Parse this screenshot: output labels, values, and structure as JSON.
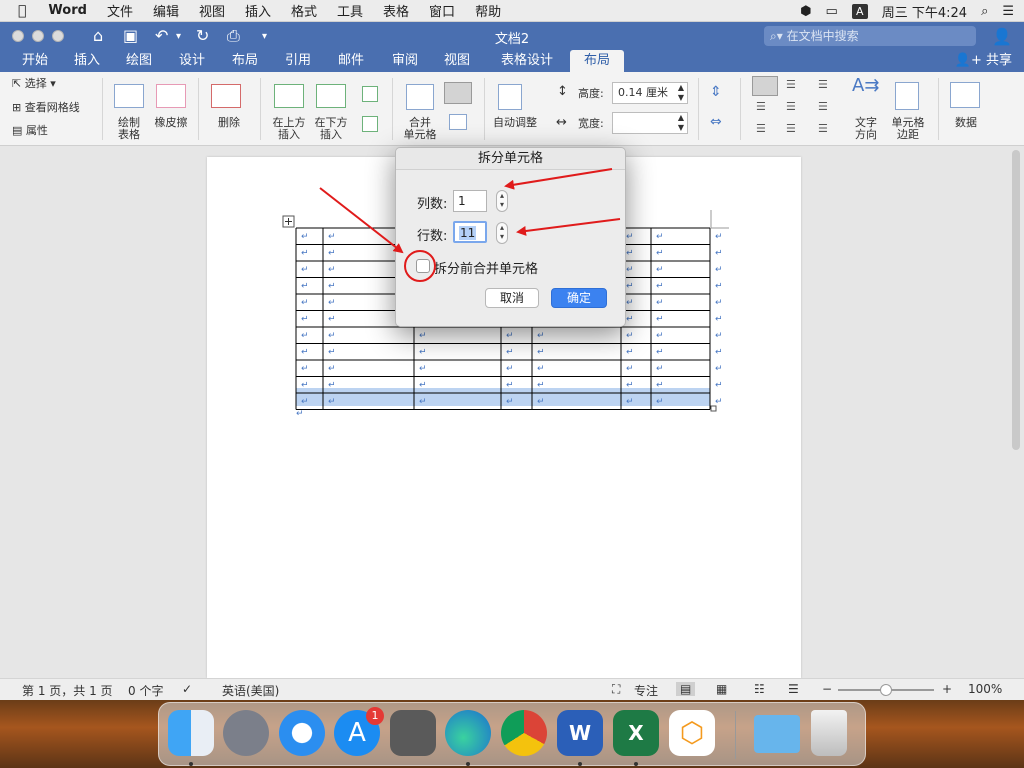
{
  "menubar": {
    "app_name": "Word",
    "items": [
      "文件",
      "编辑",
      "视图",
      "插入",
      "格式",
      "工具",
      "表格",
      "窗口",
      "帮助"
    ],
    "ime": "A",
    "clock": "周三 下午4:24"
  },
  "window": {
    "title": "文档2",
    "search_placeholder": "在文档中搜索",
    "share_label": "共享"
  },
  "tabs": [
    {
      "label": "开始",
      "active": false
    },
    {
      "label": "插入",
      "active": false
    },
    {
      "label": "绘图",
      "active": false
    },
    {
      "label": "设计",
      "active": false
    },
    {
      "label": "布局",
      "active": false
    },
    {
      "label": "引用",
      "active": false
    },
    {
      "label": "邮件",
      "active": false
    },
    {
      "label": "审阅",
      "active": false
    },
    {
      "label": "视图",
      "active": false
    },
    {
      "label": "表格设计",
      "active": false
    },
    {
      "label": "布局",
      "active": true
    }
  ],
  "ribbon": {
    "select": "选择",
    "view_gridlines": "查看网格线",
    "properties": "属性",
    "draw_table": "绘制\n表格",
    "eraser": "橡皮擦",
    "delete": "删除",
    "insert_above": "在上方\n插入",
    "insert_below": "在下方\n插入",
    "merge_cells": "合并\n单元格",
    "autofit": "自动调整",
    "height_label": "高度:",
    "height_value": "0.14 厘米",
    "width_label": "宽度:",
    "width_value": "",
    "text_direction": "文字\n方向",
    "cell_margins": "单元格\n边距",
    "data": "数据"
  },
  "dialog": {
    "title": "拆分单元格",
    "columns_label": "列数:",
    "columns_value": "1",
    "rows_label": "行数:",
    "rows_value": "11",
    "merge_label": "拆分前合并单元格",
    "merge_checked": false,
    "cancel": "取消",
    "ok": "确定"
  },
  "statusbar": {
    "page": "第 1 页，共 1 页",
    "words": "0 个字",
    "language": "英语(美国)",
    "focus": "专注",
    "zoom": "100%"
  },
  "dock": [
    "finder-icon",
    "launchpad-icon",
    "safari-icon",
    "app-store-icon",
    "system-preferences-icon",
    "edge-icon",
    "chrome-icon",
    "word-icon",
    "excel-icon",
    "office-icon",
    "folder-icon",
    "trash-icon"
  ],
  "app_store_badge": "1",
  "colors": {
    "accent": "#4a6fb0",
    "primary_button": "#3b82f0",
    "annotation": "#e01b1b",
    "selected_row": "#bcd3f1"
  }
}
